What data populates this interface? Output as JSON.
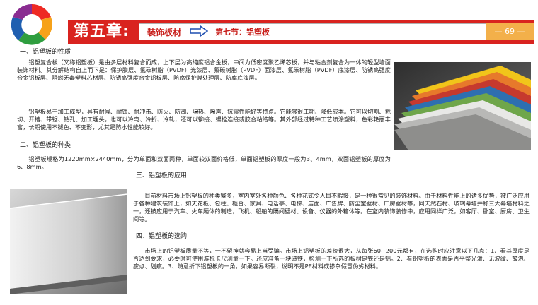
{
  "header": {
    "chapter": "第五章:",
    "section_main": "装饰板材",
    "section_sub": "第七节：铝塑板",
    "page": "— 69 —"
  },
  "colors": {
    "brand_red": "#d9231f",
    "page_badge": "#f3b04a"
  },
  "icons": {
    "logo": "star-ring-logo",
    "arrow": "right-arrow-icon"
  },
  "sections": [
    {
      "heading": "一、铝塑板的性质",
      "paragraphs": [
        "铝塑复合板（又称铝塑板）是由多层材料复合而成，上下层为高纯度铝合金板，中间为低密度聚乙烯芯板，并与粘合剂复合为一体的轻型墙面装饰材料。其分解结构自上而下是：保护膜层、氟碳树脂（PVDF）光漆层、氟碳树脂（PVDF）面漆层、氟碳树脂（PVDF）底漆层、防锈高强度合金铝板层、阻燃无毒塑料芯材层、防锈高强度合金铝板层、防腐保护膜处理层、防腐底漆层。",
        "铝塑板易于加工成型，具有耐候、耐蚀、耐冲击、防火、防潮、隔热、隔声、抗震性能好等特点。它能够很工期、降低成本。它可以切割、截切、开槽、带锯、钻孔、加工埋头，也可以冷弯、冷折、冷轧，还可以铆接、螺栓连接或胶合粘结等。其外部经过特种工艺喷涂塑料，色彩艳丽丰富，长期使用不褪色、不变形，尤其是防水性能较好。"
      ]
    },
    {
      "heading": "二、铝塑板的种类",
      "paragraphs": [
        "铝塑板规格为1220mm×2440mm，分为单面和双面两种，单面较双面价格低，单面铝塑板的厚度一般为3、4mm，双面铝塑板的厚度为6、8mm。"
      ]
    },
    {
      "heading": "三、铝塑板的应用",
      "paragraphs": [
        "目前材料市场上铝塑板的种类繁多，室内室外各种颜色、各种花式令人目不暇接，是一种很常见的装饰材料。由于材料性能上的诸多优势，被广泛应用于各种建筑装饰上，如天花板、包柱、柜台、家具、电话亭、电梯、店面、广告牌、防尘室壁材、厂房壁材等，同天然石材、玻璃幕墙并称三大幕墙材料之一，还被应用于汽车、火车厢体的制造，飞机、船舶的隔间壁材、设备、仪器的外箱体等。在室内装饰装修中，应用同样广泛，如客厅、卧室、厨房、卫生间等。"
      ]
    },
    {
      "heading": "四、铝塑板的选购",
      "paragraphs": [
        "市场上的铝塑板质量不等，一不留神就容易上当受骗。市场上铝塑板的差价很大，从每张60~200元都有，在选购时应注意以下几点：1、看其厚度是否达到要求，必要时可使用游标卡尺测量一下。还应准备一块磁铁，检测一下所选的板材是铁还是铝。2、看铝塑板的表面是否平整光滑、无波纹、鼓泡、疵点、划痕。3、随意折下铝塑板的一角，如果容易断裂，说明不是PE材料或掺杂假冒伪劣材料。"
      ]
    }
  ]
}
